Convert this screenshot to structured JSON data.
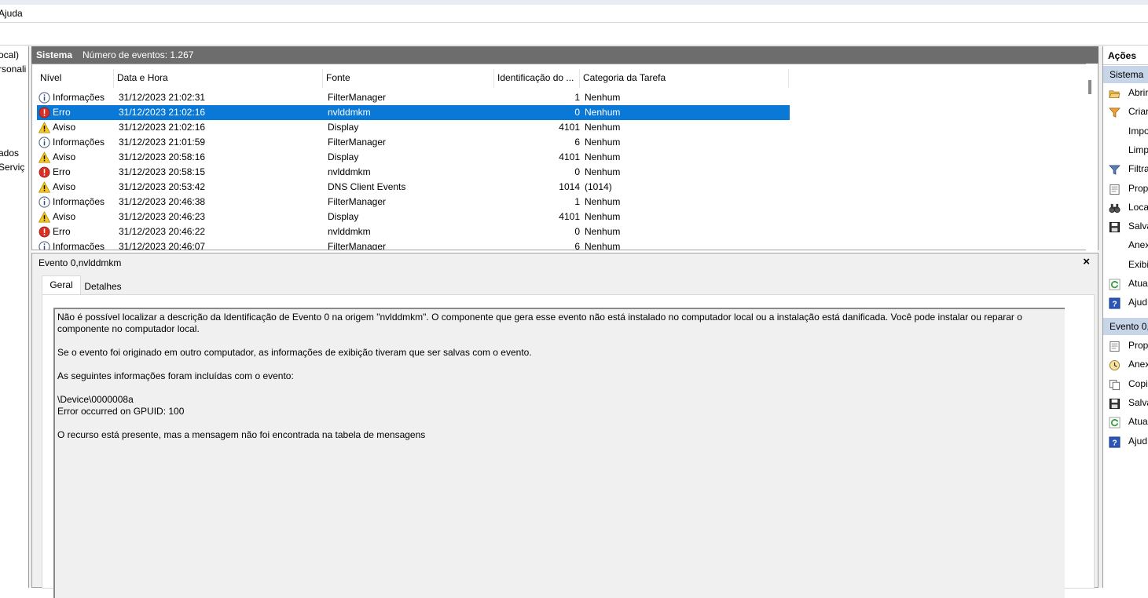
{
  "menu": {
    "help": "Ajuda"
  },
  "tree": {
    "items": [
      "ocal)",
      "rsonali",
      "ados",
      "Serviç"
    ]
  },
  "header": {
    "title": "Sistema",
    "count": "Número de eventos: 1.267"
  },
  "columns": [
    "Nível",
    "Data e Hora",
    "Fonte",
    "Identificação do ...",
    "Categoria da Tarefa"
  ],
  "events": [
    {
      "level": "Informações",
      "icon": "info-icon",
      "datetime": "31/12/2023 21:02:31",
      "source": "FilterManager",
      "id": "1",
      "category": "Nenhum"
    },
    {
      "level": "Erro",
      "icon": "error-icon",
      "datetime": "31/12/2023 21:02:16",
      "source": "nvlddmkm",
      "id": "0",
      "category": "Nenhum",
      "selected": true
    },
    {
      "level": "Aviso",
      "icon": "warning-icon",
      "datetime": "31/12/2023 21:02:16",
      "source": "Display",
      "id": "4101",
      "category": "Nenhum"
    },
    {
      "level": "Informações",
      "icon": "info-icon",
      "datetime": "31/12/2023 21:01:59",
      "source": "FilterManager",
      "id": "6",
      "category": "Nenhum"
    },
    {
      "level": "Aviso",
      "icon": "warning-icon",
      "datetime": "31/12/2023 20:58:16",
      "source": "Display",
      "id": "4101",
      "category": "Nenhum"
    },
    {
      "level": "Erro",
      "icon": "error-icon",
      "datetime": "31/12/2023 20:58:15",
      "source": "nvlddmkm",
      "id": "0",
      "category": "Nenhum"
    },
    {
      "level": "Aviso",
      "icon": "warning-icon",
      "datetime": "31/12/2023 20:53:42",
      "source": "DNS Client Events",
      "id": "1014",
      "category": "(1014)"
    },
    {
      "level": "Informações",
      "icon": "info-icon",
      "datetime": "31/12/2023 20:46:38",
      "source": "FilterManager",
      "id": "1",
      "category": "Nenhum"
    },
    {
      "level": "Aviso",
      "icon": "warning-icon",
      "datetime": "31/12/2023 20:46:23",
      "source": "Display",
      "id": "4101",
      "category": "Nenhum"
    },
    {
      "level": "Erro",
      "icon": "error-icon",
      "datetime": "31/12/2023 20:46:22",
      "source": "nvlddmkm",
      "id": "0",
      "category": "Nenhum"
    },
    {
      "level": "Informações",
      "icon": "info-icon",
      "datetime": "31/12/2023 20:46:07",
      "source": "FilterManager",
      "id": "6",
      "category": "Nenhum"
    }
  ],
  "detail": {
    "title": "Evento 0,nvlddmkm",
    "close": "×",
    "tabs": {
      "general": "Geral",
      "details": "Detalhes"
    },
    "paragraphs": [
      "Não é possível localizar a descrição da Identificação de Evento 0 na origem \"nvlddmkm\". O componente que gera esse evento não está instalado no computador local ou a instalação está danificada. Você pode instalar ou reparar o componente no computador local.",
      "Se o evento foi originado em outro computador, as informações de exibição tiveram que ser salvas com o evento.",
      "As seguintes informações foram incluídas com o evento:",
      "\\Device\\0000008a\nError occurred on GPUID: 100",
      "O recurso está presente, mas a mensagem não foi encontrada na tabela de mensagens"
    ]
  },
  "actions": {
    "title": "Ações",
    "section1": "Sistema",
    "items1": [
      {
        "label": "Abrir",
        "icon": "folder-open-icon"
      },
      {
        "label": "Criar",
        "icon": "filter-create-icon"
      },
      {
        "label": "Impo",
        "icon": ""
      },
      {
        "label": "Limp",
        "icon": ""
      },
      {
        "label": "Filtra",
        "icon": "filter-icon"
      },
      {
        "label": "Prop",
        "icon": "properties-icon"
      },
      {
        "label": "Loca",
        "icon": "binoculars-icon"
      },
      {
        "label": "Salva",
        "icon": "save-icon"
      },
      {
        "label": "Anex",
        "icon": ""
      },
      {
        "label": "Exibi",
        "icon": ""
      },
      {
        "label": "Atua",
        "icon": "refresh-icon"
      },
      {
        "label": "Ajud",
        "icon": "help-icon"
      }
    ],
    "section2": "Evento 0,",
    "items2": [
      {
        "label": "Prop",
        "icon": "properties-icon"
      },
      {
        "label": "Anex",
        "icon": "task-clock-icon"
      },
      {
        "label": "Copi",
        "icon": "copy-icon"
      },
      {
        "label": "Salva",
        "icon": "save-icon"
      },
      {
        "label": "Atua",
        "icon": "refresh-icon"
      },
      {
        "label": "Ajud",
        "icon": "help-icon"
      }
    ]
  },
  "colors": {
    "selection": "#0a78d7",
    "header_bg": "#6d6d6d",
    "action_section": "#c7d5e8"
  }
}
